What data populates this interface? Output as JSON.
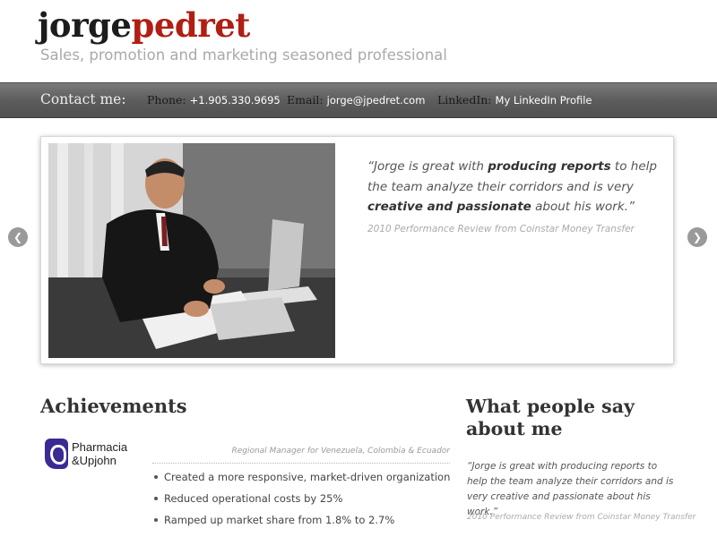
{
  "header": {
    "logo_first": "jorge",
    "logo_last": "pedret",
    "tagline": "Sales, promotion and marketing seasoned professional"
  },
  "contact": {
    "title": "Contact me:",
    "phone_label": "Phone:",
    "phone_value": "+1.905.330.9695",
    "email_label": "Email:",
    "email_value": "jorge@jpedret.com",
    "linkedin_label": "LinkedIn:",
    "linkedin_value": "My LinkedIn Profile"
  },
  "slider": {
    "quote_open": "“Jorge is great with ",
    "quote_bold1": "producing reports",
    "quote_mid": " to help the team analyze their corridors and is very ",
    "quote_bold2": "creative and passionate",
    "quote_end": " about his work.”",
    "source": "2010 Performance Review from Coinstar Money Transfer",
    "prev_icon": "chevron-left-icon",
    "next_icon": "chevron-right-icon"
  },
  "achievements": {
    "title": "Achievements",
    "company_line1": "Pharmacia",
    "company_line2": "&Upjohn",
    "role": "Regional Manager for Venezuela, Colombia & Ecuador",
    "items": [
      "Created a more responsive, market-driven organization",
      "Reduced operational costs by 25%",
      "Ramped up market share from 1.8% to 2.7%"
    ]
  },
  "testimonials": {
    "title": "What people say about me",
    "quote": "“Jorge is great with producing reports to help the team analyze their corridors and is very creative and passionate about his work.”",
    "source": "2010 Performance Review from Coinstar Money Transfer"
  }
}
